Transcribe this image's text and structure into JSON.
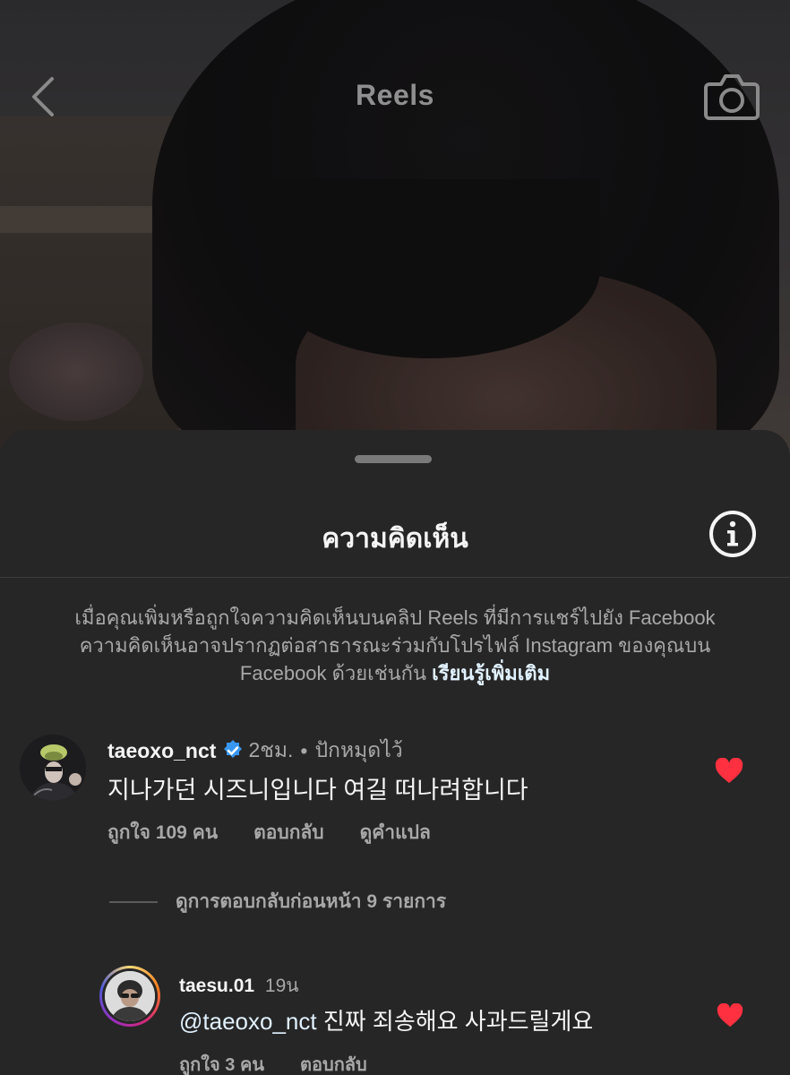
{
  "header": {
    "title": "Reels"
  },
  "sheet": {
    "title": "ความคิดเห็น",
    "notice_text": "เมื่อคุณเพิ่มหรือถูกใจความคิดเห็นบนคลิป Reels ที่มีการแชร์ไปยัง Facebook ความคิดเห็นอาจปรากฏต่อสาธารณะร่วมกับโปรไฟล์ Instagram ของคุณบน Facebook ด้วยเช่นกัน",
    "notice_link": "เรียนรู้เพิ่มเติม"
  },
  "comments": [
    {
      "username": "taeoxo_nct",
      "verified": true,
      "time": "2ชม.",
      "pinned_label": "ปักหมุดไว้",
      "text": "지나가던 시즈니입니다 여길 떠나려합니다",
      "likes_label": "ถูกใจ 109 คน",
      "reply_label": "ตอบกลับ",
      "translate_label": "ดูคำแปล",
      "liked": true
    }
  ],
  "replies_toggle": {
    "label": "ดูการตอบกลับก่อนหน้า 9 รายการ"
  },
  "replies": [
    {
      "username": "taesu.01",
      "time": "19น",
      "mention": "@taeoxo_nct",
      "text": " 진짜 죄송해요 사과드릴게요",
      "likes_label": "ถูกใจ 3 คน",
      "reply_label": "ตอบกลับ",
      "liked": true,
      "has_story_ring": true
    }
  ],
  "colors": {
    "background": "#262626",
    "heart": "#ff3040",
    "link": "#e0f1ff",
    "verified": "#3897f0",
    "secondary_text": "#a8a8a8"
  },
  "icons": {
    "back": "chevron-left-icon",
    "camera": "camera-icon",
    "info": "info-icon",
    "verified": "verified-badge-icon",
    "like": "heart-icon"
  }
}
